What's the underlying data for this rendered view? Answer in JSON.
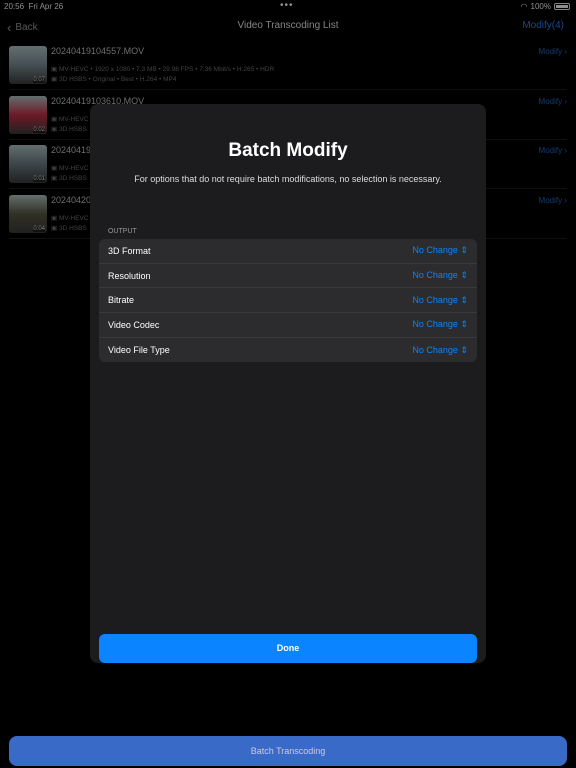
{
  "status": {
    "time": "20:56",
    "date": "Fri Apr 26",
    "battery": "100%"
  },
  "nav": {
    "back": "Back",
    "title": "Video Transcoding List",
    "modify_all": "Modify(4)"
  },
  "items": [
    {
      "name": "20240419104557.MOV",
      "duration": "0:07",
      "source": "MV-HEVC • 1920 x 1080 • 7.3 MB • 29.98 FPS • 7.36 Mbit/s • H.265 • HDR",
      "output": "3D HSBS • Original • Best • H.264 • MP4",
      "modify": "Modify",
      "thumb": "#6b7a80"
    },
    {
      "name": "20240419103610.MOV",
      "duration": "0:02",
      "source": "MV-HEVC",
      "output": "3D HSBS",
      "modify": "Modify",
      "thumb": "#a8283a"
    },
    {
      "name": "20240419",
      "duration": "0:01",
      "source": "MV-HEVC",
      "output": "3D HSBS",
      "modify": "Modify",
      "thumb": "#5d6a70"
    },
    {
      "name": "20240420",
      "duration": "0:04",
      "source": "MV-HEVC",
      "output": "3D HSBS",
      "modify": "Modify",
      "thumb": "#4a4a3a"
    }
  ],
  "modal": {
    "title": "Batch Modify",
    "subtitle": "For options that do not require batch modifications, no selection is necessary.",
    "section": "OUTPUT",
    "options": [
      {
        "label": "3D Format",
        "value": "No Change"
      },
      {
        "label": "Resolution",
        "value": "No Change"
      },
      {
        "label": "Bitrate",
        "value": "No Change"
      },
      {
        "label": "Video Codec",
        "value": "No Change"
      },
      {
        "label": "Video File Type",
        "value": "No Change"
      }
    ],
    "done": "Done"
  },
  "batch_button": "Batch Transcoding"
}
